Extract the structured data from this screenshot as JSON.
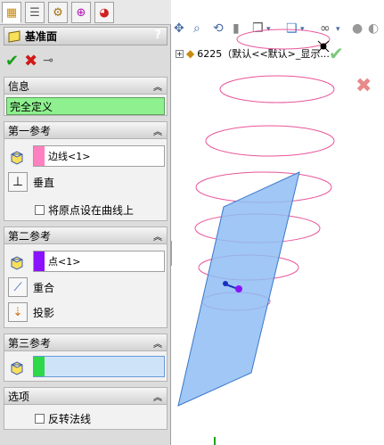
{
  "panel": {
    "title": "基准面",
    "help": "?",
    "info": {
      "header": "信息",
      "status": "完全定义"
    },
    "ref1": {
      "header": "第一参考",
      "value": "边线<1>",
      "swatch": "#ff80c0",
      "opt1": "垂直",
      "checkbox": "将原点设在曲线上"
    },
    "ref2": {
      "header": "第二参考",
      "value": "点<1>",
      "swatch": "#8a12ff",
      "opt1": "重合",
      "opt2": "投影"
    },
    "ref3": {
      "header": "第三参考",
      "value": "",
      "swatch": "#2fd84a"
    },
    "options": {
      "header": "选项",
      "checkbox": "反转法线"
    }
  },
  "tree": {
    "label": "6225（默认<<默认>_显示..."
  },
  "colors": {
    "plane": "#8fbdf3",
    "helix": "#e8559a",
    "status_green": "#8ef08e"
  }
}
